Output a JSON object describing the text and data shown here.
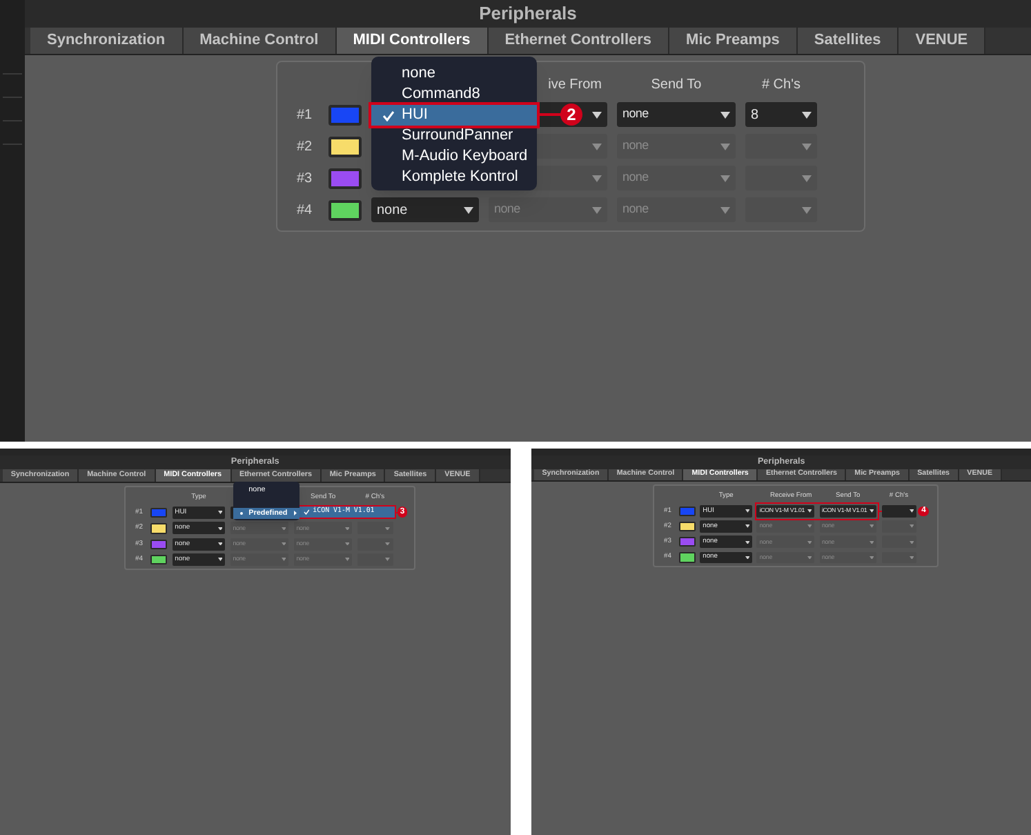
{
  "panels": [
    {
      "title": "Peripherals",
      "tabs": [
        {
          "label": "Synchronization",
          "selected": false
        },
        {
          "label": "Machine Control",
          "selected": false
        },
        {
          "label": "MIDI Controllers",
          "selected": true
        },
        {
          "label": "Ethernet Controllers",
          "selected": false
        },
        {
          "label": "Mic Preamps",
          "selected": false
        },
        {
          "label": "Satellites",
          "selected": false
        },
        {
          "label": "VENUE",
          "selected": false
        }
      ],
      "headers": {
        "receive": "ive From",
        "send": "Send To",
        "channels": "# Ch's"
      },
      "rows": [
        {
          "label": "#1",
          "color": "#1846f5",
          "receive": {
            "disabled": false
          },
          "send": {
            "value": "none",
            "disabled": false
          },
          "channels": {
            "value": "8",
            "disabled": false
          }
        },
        {
          "label": "#2",
          "color": "#f7dc6a",
          "receive": {
            "disabled": true
          },
          "send": {
            "value": "none",
            "disabled": true
          },
          "channels": {
            "disabled": true
          }
        },
        {
          "label": "#3",
          "color": "#9a4cf2",
          "receive": {
            "disabled": true
          },
          "send": {
            "value": "none",
            "disabled": true
          },
          "channels": {
            "disabled": true
          }
        },
        {
          "label": "#4",
          "color": "#5fd35f",
          "type": {
            "value": "none",
            "disabled": false
          },
          "receive": {
            "value": "none",
            "disabled": true
          },
          "send": {
            "value": "none",
            "disabled": true
          },
          "channels": {
            "disabled": true
          }
        }
      ],
      "menu": {
        "kind": "type",
        "items": [
          {
            "label": "none",
            "selected": false,
            "checked": false
          },
          {
            "label": "Command8",
            "selected": false,
            "checked": false
          },
          {
            "label": "HUI",
            "selected": true,
            "checked": true
          },
          {
            "label": "SurroundPanner",
            "selected": false,
            "checked": false
          },
          {
            "label": "M-Audio Keyboard",
            "selected": false,
            "checked": false
          },
          {
            "label": "Komplete Kontrol",
            "selected": false,
            "checked": false
          }
        ]
      },
      "callout": {
        "label": "2",
        "kind": "menu"
      }
    },
    {
      "title": "Peripherals",
      "tabs": [
        {
          "label": "Synchronization",
          "selected": false
        },
        {
          "label": "Machine Control",
          "selected": false
        },
        {
          "label": "MIDI Controllers",
          "selected": true
        },
        {
          "label": "Ethernet Controllers",
          "selected": false
        },
        {
          "label": "Mic Preamps",
          "selected": false
        },
        {
          "label": "Satellites",
          "selected": false
        },
        {
          "label": "VENUE",
          "selected": false
        }
      ],
      "headers": {
        "type": "Type",
        "send": "Send To",
        "channels": "# Ch's"
      },
      "rows": [
        {
          "label": "#1",
          "color": "#1846f5",
          "type": {
            "value": "HUI",
            "disabled": false
          },
          "receive": {
            "disabled": false
          }
        },
        {
          "label": "#2",
          "color": "#f7dc6a",
          "type": {
            "value": "none",
            "disabled": false
          },
          "receive": {
            "value": "none",
            "disabled": true
          },
          "send": {
            "value": "none",
            "disabled": true
          },
          "channels": {
            "disabled": true
          }
        },
        {
          "label": "#3",
          "color": "#9a4cf2",
          "type": {
            "value": "none",
            "disabled": false
          },
          "receive": {
            "value": "none",
            "disabled": true
          },
          "send": {
            "value": "none",
            "disabled": true
          },
          "channels": {
            "disabled": true
          }
        },
        {
          "label": "#4",
          "color": "#5fd35f",
          "type": {
            "value": "none",
            "disabled": false
          },
          "receive": {
            "value": "none",
            "disabled": true
          },
          "send": {
            "value": "none",
            "disabled": true
          },
          "channels": {
            "disabled": true
          }
        }
      ],
      "menu": {
        "kind": "receive",
        "items": [
          {
            "label": "none",
            "selected": false,
            "bullet": false
          },
          {
            "label": "Predefined",
            "selected": true,
            "bullet": true,
            "submenu": [
              {
                "label": "iCON V1-M V1.01",
                "selected": true,
                "checked": true
              }
            ]
          }
        ]
      },
      "callout": {
        "label": "3",
        "kind": "submenu"
      }
    },
    {
      "title": "Peripherals",
      "tabs": [
        {
          "label": "Synchronization",
          "selected": false
        },
        {
          "label": "Machine Control",
          "selected": false
        },
        {
          "label": "MIDI Controllers",
          "selected": true
        },
        {
          "label": "Ethernet Controllers",
          "selected": false
        },
        {
          "label": "Mic Preamps",
          "selected": false
        },
        {
          "label": "Satellites",
          "selected": false
        },
        {
          "label": "VENUE",
          "selected": false
        }
      ],
      "headers": {
        "type": "Type",
        "receive": "Receive From",
        "send": "Send To",
        "channels": "# Ch's"
      },
      "rows": [
        {
          "label": "#1",
          "color": "#1846f5",
          "type": {
            "value": "HUI",
            "disabled": false
          },
          "receive": {
            "value": "iCON V1-M V1.01",
            "disabled": false
          },
          "send": {
            "value": "iCON V1-M V1.01",
            "disabled": false
          },
          "channels": {
            "disabled": false
          }
        },
        {
          "label": "#2",
          "color": "#f7dc6a",
          "type": {
            "value": "none",
            "disabled": false
          },
          "receive": {
            "value": "none",
            "disabled": true
          },
          "send": {
            "value": "none",
            "disabled": true
          },
          "channels": {
            "disabled": true
          }
        },
        {
          "label": "#3",
          "color": "#9a4cf2",
          "type": {
            "value": "none",
            "disabled": false
          },
          "receive": {
            "value": "none",
            "disabled": true
          },
          "send": {
            "value": "none",
            "disabled": true
          },
          "channels": {
            "disabled": true
          }
        },
        {
          "label": "#4",
          "color": "#5fd35f",
          "type": {
            "value": "none",
            "disabled": false
          },
          "receive": {
            "value": "none",
            "disabled": true
          },
          "send": {
            "value": "none",
            "disabled": true
          },
          "channels": {
            "disabled": true
          }
        }
      ],
      "callout": {
        "label": "4",
        "kind": "fields"
      }
    }
  ]
}
